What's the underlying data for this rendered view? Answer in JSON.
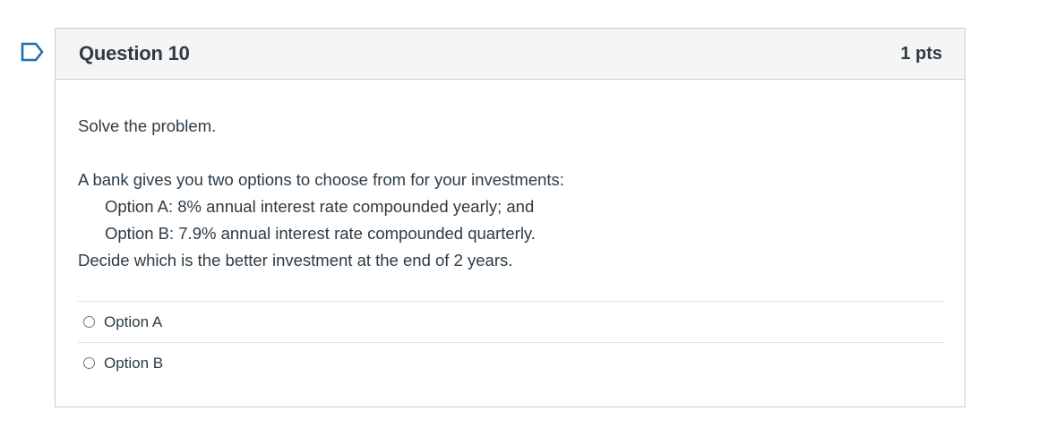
{
  "question": {
    "title": "Question 10",
    "points": "1 pts",
    "intro": "Solve the problem.",
    "problem_lines": [
      "A bank gives you two options to choose from for your investments:",
      "Option A: 8% annual interest rate compounded yearly; and",
      "Option B: 7.9% annual interest rate compounded quarterly.",
      "Decide which is the better investment at the end of 2 years."
    ],
    "answers": [
      {
        "label": "Option A",
        "selected": false
      },
      {
        "label": "Option B",
        "selected": false
      }
    ]
  },
  "colors": {
    "header_bg": "#f5f5f5",
    "border": "#c7cdd1",
    "text": "#2d3b45",
    "flag_stroke": "#1d6fb8"
  },
  "icons": {
    "flag": "flag-question-icon",
    "radio": "radio-unchecked-icon"
  }
}
